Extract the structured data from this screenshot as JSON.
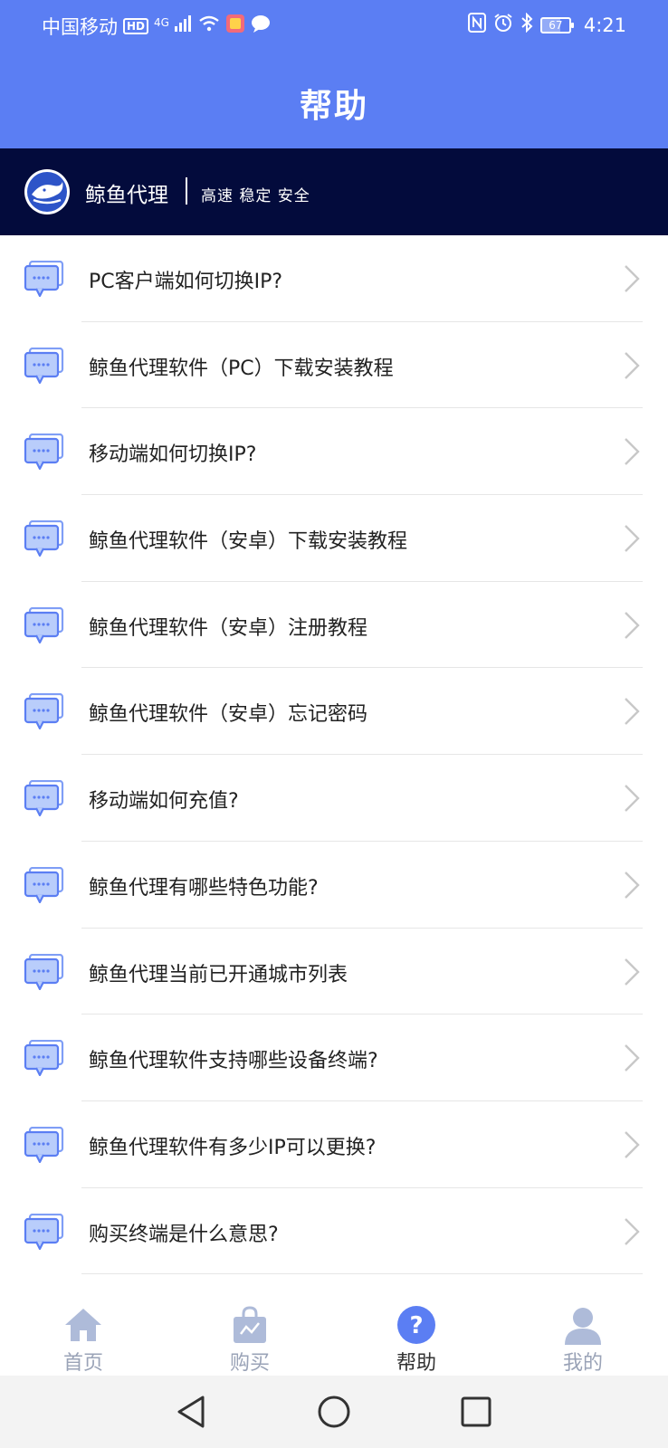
{
  "status_bar": {
    "carrier": "中国移动",
    "hd_badge": "HD",
    "network": "4G",
    "battery_level": "67",
    "time": "4:21",
    "icons": [
      "signal-icon",
      "wifi-icon",
      "app-notification-icon",
      "message-icon",
      "nfc-icon",
      "alarm-icon",
      "bluetooth-icon",
      "battery-icon"
    ]
  },
  "header": {
    "title": "帮助"
  },
  "brand": {
    "name": "鲸鱼代理",
    "tagline": "高速 稳定 安全"
  },
  "faq": [
    "PC客户端如何切换IP?",
    "鲸鱼代理软件（PC）下载安装教程",
    "移动端如何切换IP?",
    "鲸鱼代理软件（安卓）下载安装教程",
    "鲸鱼代理软件（安卓）注册教程",
    "鲸鱼代理软件（安卓）忘记密码",
    "移动端如何充值?",
    "鲸鱼代理有哪些特色功能?",
    "鲸鱼代理当前已开通城市列表",
    "鲸鱼代理软件支持哪些设备终端?",
    "鲸鱼代理软件有多少IP可以更换?",
    "购买终端是什么意思?"
  ],
  "tabs": [
    {
      "label": "首页",
      "icon": "home-icon",
      "active": false
    },
    {
      "label": "购买",
      "icon": "shopping-bag-icon",
      "active": false
    },
    {
      "label": "帮助",
      "icon": "help-icon",
      "active": true
    },
    {
      "label": "我的",
      "icon": "user-icon",
      "active": false
    }
  ],
  "system_nav": [
    "back-icon",
    "home-circle-icon",
    "recents-icon"
  ],
  "colors": {
    "primary": "#5b7ef3",
    "brand_bar": "#030b3c",
    "tab_inactive": "#9aa3b7"
  }
}
